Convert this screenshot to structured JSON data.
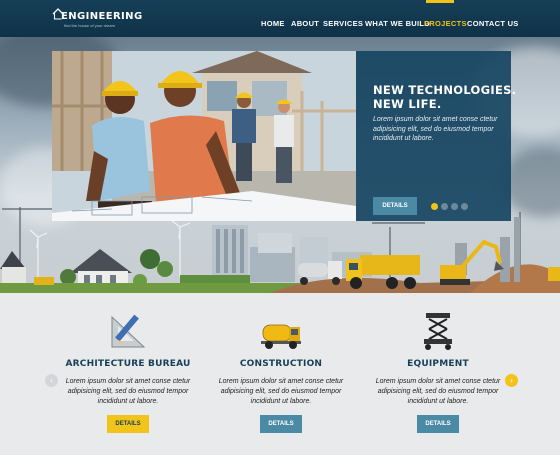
{
  "header": {
    "logo_title": "ENGINEERING",
    "logo_tagline": "find the house of your dream",
    "nav": [
      {
        "label": "HOME",
        "active": false
      },
      {
        "label": "ABOUT",
        "active": false
      },
      {
        "label": "SERVICES",
        "active": false
      },
      {
        "label": "WHAT WE BUILD",
        "active": false
      },
      {
        "label": "PROJECTS",
        "active": true
      },
      {
        "label": "CONTACT US",
        "active": false
      }
    ]
  },
  "hero": {
    "title_line1": "NEW TECHNOLOGIES.",
    "title_line2": "NEW LIFE.",
    "text": "Lorem ipsum dolor sit amet conse ctetur adipisicing elit, sed do eiusmod tempor incididunt ut labore.",
    "button_label": "DETAILS",
    "slides": 4,
    "active_slide": 1
  },
  "features": [
    {
      "title": "ARCHITECTURE BUREAU",
      "icon": "drafting-ruler-pencil-icon",
      "text": "Lorem ipsum dolor sit amet conse ctetur adipisicing elit, sed do eiusmod tempor incididunt ut labore.",
      "button_label": "DETAILS",
      "button_style": "yellow"
    },
    {
      "title": "CONSTRUCTION",
      "icon": "concrete-mixer-truck-icon",
      "text": "Lorem ipsum dolor sit amet conse ctetur adipisicing elit, sed do eiusmod tempor incididunt ut labore.",
      "button_label": "DETAILS",
      "button_style": "blue"
    },
    {
      "title": "EQUIPMENT",
      "icon": "scissor-lift-icon",
      "text": "Lorem ipsum dolor sit amet conse ctetur adipisicing elit, sed do eiusmod tempor incididunt ut labore.",
      "button_label": "DETAILS",
      "button_style": "blue"
    }
  ],
  "colors": {
    "header_bg": "#163f57",
    "accent": "#f2c318",
    "caption_bg": "#184662",
    "button_blue": "#4b8aa5",
    "title_navy": "#173f58"
  }
}
